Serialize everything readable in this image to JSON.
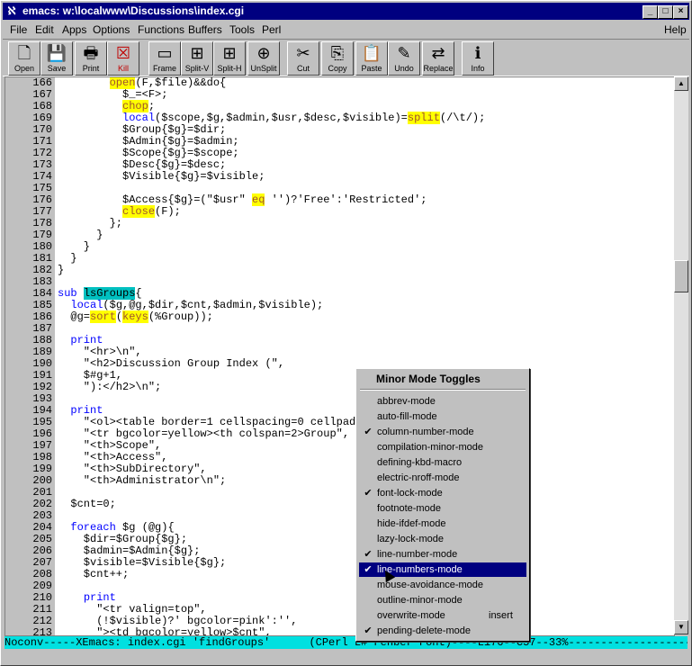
{
  "window": {
    "title": "emacs: w:\\localwww\\Discussions\\index.cgi"
  },
  "menu": [
    "File",
    "Edit",
    "Apps",
    "Options",
    "Functions",
    "Buffers",
    "Tools",
    "Perl",
    "Help"
  ],
  "toolbar": [
    {
      "icon": "document-icon",
      "glyph": "🗋",
      "label": "Open"
    },
    {
      "icon": "save-icon",
      "glyph": "💾",
      "label": "Save"
    },
    {
      "icon": "print-icon",
      "glyph": "🖶",
      "label": "Print"
    },
    {
      "icon": "kill-icon",
      "glyph": "☒",
      "label": "Kill"
    },
    {
      "icon": "frame-icon",
      "glyph": "▭",
      "label": "Frame"
    },
    {
      "icon": "split-v-icon",
      "glyph": "⊞",
      "label": "Split-V"
    },
    {
      "icon": "split-h-icon",
      "glyph": "⊞",
      "label": "Split-H"
    },
    {
      "icon": "unsplit-icon",
      "glyph": "⊕",
      "label": "UnSplit"
    },
    {
      "icon": "scissors-icon",
      "glyph": "✂",
      "label": "Cut"
    },
    {
      "icon": "copy-icon",
      "glyph": "⎘",
      "label": "Copy"
    },
    {
      "icon": "paste-icon",
      "glyph": "📋",
      "label": "Paste"
    },
    {
      "icon": "undo-icon",
      "glyph": "✎",
      "label": "Undo"
    },
    {
      "icon": "replace-icon",
      "glyph": "⇄",
      "label": "Replace"
    },
    {
      "icon": "info-icon",
      "glyph": "ℹ",
      "label": "Info"
    }
  ],
  "code": [
    {
      "n": "166",
      "t": "        open(F,$file)&&do{"
    },
    {
      "n": "167",
      "t": "          $_=<F>;"
    },
    {
      "n": "168",
      "t": "          chop;"
    },
    {
      "n": "169",
      "t": "          local($scope,$g,$admin,$usr,$desc,$visible)=split(/\\t/);"
    },
    {
      "n": "170",
      "t": "          $Group{$g}=$dir;"
    },
    {
      "n": "171",
      "t": "          $Admin{$g}=$admin;"
    },
    {
      "n": "172",
      "t": "          $Scope{$g}=$scope;"
    },
    {
      "n": "173",
      "t": "          $Desc{$g}=$desc;"
    },
    {
      "n": "174",
      "t": "          $Visible{$g}=$visible;"
    },
    {
      "n": "175",
      "t": ""
    },
    {
      "n": "176",
      "t": "          $Access{$g}=(\"$usr\" eq '')?'Free':'Restricted';"
    },
    {
      "n": "177",
      "t": "          close(F);"
    },
    {
      "n": "178",
      "t": "        };"
    },
    {
      "n": "179",
      "t": "      }"
    },
    {
      "n": "180",
      "t": "    }"
    },
    {
      "n": "181",
      "t": "  }"
    },
    {
      "n": "182",
      "t": "}"
    },
    {
      "n": "183",
      "t": ""
    },
    {
      "n": "184",
      "t": "sub lsGroups{"
    },
    {
      "n": "185",
      "t": "  local($g,@g,$dir,$cnt,$admin,$visible);"
    },
    {
      "n": "186",
      "t": "  @g=sort(keys(%Group));"
    },
    {
      "n": "187",
      "t": ""
    },
    {
      "n": "188",
      "t": "  print"
    },
    {
      "n": "189",
      "t": "    \"<hr>\\n\","
    },
    {
      "n": "190",
      "t": "    \"<h2>Discussion Group Index (\","
    },
    {
      "n": "191",
      "t": "    $#g+1,"
    },
    {
      "n": "192",
      "t": "    \"):</h2>\\n\";"
    },
    {
      "n": "193",
      "t": ""
    },
    {
      "n": "194",
      "t": "  print"
    },
    {
      "n": "195",
      "t": "    \"<ol><table border=1 cellspacing=0 cellpadd"
    },
    {
      "n": "196",
      "t": "    \"<tr bgcolor=yellow><th colspan=2>Group\","
    },
    {
      "n": "197",
      "t": "    \"<th>Scope\","
    },
    {
      "n": "198",
      "t": "    \"<th>Access\","
    },
    {
      "n": "199",
      "t": "    \"<th>SubDirectory\","
    },
    {
      "n": "200",
      "t": "    \"<th>Administrator\\n\";"
    },
    {
      "n": "201",
      "t": ""
    },
    {
      "n": "202",
      "t": "  $cnt=0;"
    },
    {
      "n": "203",
      "t": ""
    },
    {
      "n": "204",
      "t": "  foreach $g (@g){"
    },
    {
      "n": "205",
      "t": "    $dir=$Group{$g};"
    },
    {
      "n": "206",
      "t": "    $admin=$Admin{$g};"
    },
    {
      "n": "207",
      "t": "    $visible=$Visible{$g};"
    },
    {
      "n": "208",
      "t": "    $cnt++;"
    },
    {
      "n": "209",
      "t": ""
    },
    {
      "n": "210",
      "t": "    print"
    },
    {
      "n": "211",
      "t": "      \"<tr valign=top\","
    },
    {
      "n": "212",
      "t": "      (!$visible)?' bgcolor=pink':'',"
    },
    {
      "n": "213",
      "t": "      \"><td bgcolor=yellow>$cnt\","
    }
  ],
  "modeline": "Noconv-----XEmacs: index.cgi 'findGroups'      (CPerl L# Fenber Font)----L176--C57--33%-------------------",
  "popup": {
    "title": "Minor Mode Toggles",
    "items": [
      {
        "label": "abbrev-mode",
        "checked": false,
        "key": ""
      },
      {
        "label": "auto-fill-mode",
        "checked": false,
        "key": ""
      },
      {
        "label": "column-number-mode",
        "checked": true,
        "key": ""
      },
      {
        "label": "compilation-minor-mode",
        "checked": false,
        "key": ""
      },
      {
        "label": "defining-kbd-macro",
        "checked": false,
        "key": ""
      },
      {
        "label": "electric-nroff-mode",
        "checked": false,
        "key": ""
      },
      {
        "label": "font-lock-mode",
        "checked": true,
        "key": ""
      },
      {
        "label": "footnote-mode",
        "checked": false,
        "key": ""
      },
      {
        "label": "hide-ifdef-mode",
        "checked": false,
        "key": ""
      },
      {
        "label": "lazy-lock-mode",
        "checked": false,
        "key": ""
      },
      {
        "label": "line-number-mode",
        "checked": true,
        "key": ""
      },
      {
        "label": "line-numbers-mode",
        "checked": true,
        "key": "",
        "selected": true
      },
      {
        "label": "mouse-avoidance-mode",
        "checked": false,
        "key": ""
      },
      {
        "label": "outline-minor-mode",
        "checked": false,
        "key": ""
      },
      {
        "label": "overwrite-mode",
        "checked": false,
        "key": "insert"
      },
      {
        "label": "pending-delete-mode",
        "checked": true,
        "key": ""
      }
    ]
  }
}
